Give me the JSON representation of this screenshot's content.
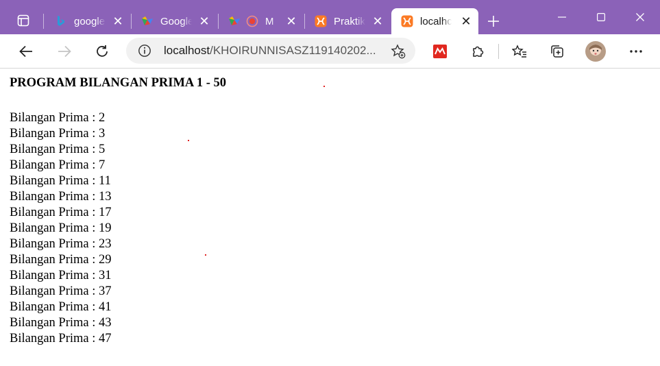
{
  "browser": {
    "tabs": [
      {
        "title": "google",
        "icon": "bing-icon"
      },
      {
        "title": "Google",
        "icon": "google-workspace-icon"
      },
      {
        "title": "M",
        "icon": "google-workspace-icon"
      },
      {
        "title": "Praktik",
        "icon": "xampp-icon"
      },
      {
        "title": "localhc",
        "icon": "xampp-icon",
        "active": true
      }
    ],
    "address": {
      "host": "localhost",
      "path": "/KHOIRUNNISASZ119140202..."
    },
    "accent": "#8b62b8"
  },
  "page": {
    "heading": "PROGRAM BILANGAN PRIMA 1 - 50",
    "label": "Bilangan Prima :",
    "primes": [
      2,
      3,
      5,
      7,
      11,
      13,
      17,
      19,
      23,
      29,
      31,
      37,
      41,
      43,
      47
    ]
  }
}
